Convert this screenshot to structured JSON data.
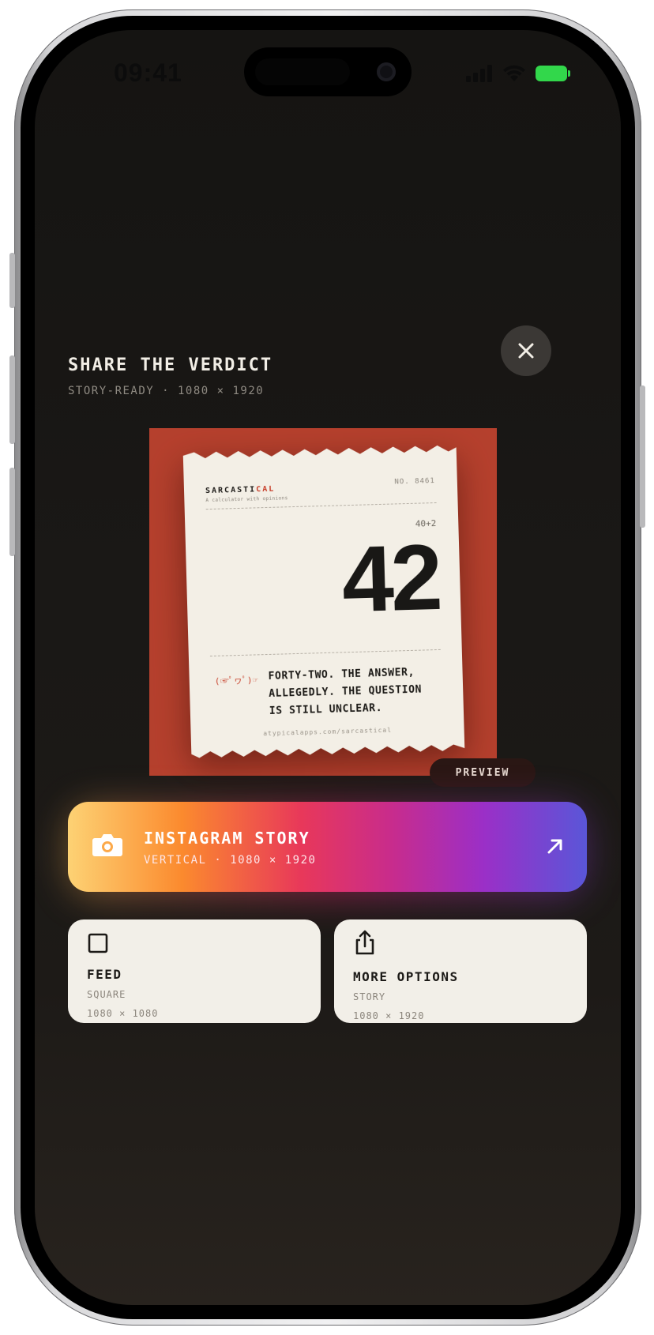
{
  "status_bar": {
    "time": "09:41"
  },
  "sheet": {
    "title": "SHARE THE VERDICT",
    "subtitle": "STORY-READY · 1080 × 1920",
    "close_icon": "close-icon"
  },
  "receipt": {
    "brand_main": "SARCASTI",
    "brand_accent": "CAL",
    "tagline": "A calculator with opinions",
    "ticket_no": "NO. 8461",
    "expression": "40+2",
    "result": "42",
    "face": "(☞ﾟヮﾟ)☞",
    "verdict": "FORTY-TWO. THE ANSWER, ALLEGEDLY. THE QUESTION IS STILL UNCLEAR.",
    "footer": "atypicalapps.com/sarcastical",
    "background": "#b5402d"
  },
  "preview_badge": "PREVIEW",
  "instagram": {
    "title": "INSTAGRAM STORY",
    "subtitle": "VERTICAL · 1080 × 1920",
    "icon": "camera-icon",
    "arrow_icon": "arrow-up-right-icon"
  },
  "options": [
    {
      "title": "FEED",
      "kind": "SQUARE",
      "size": "1080 × 1080",
      "icon": "square-icon"
    },
    {
      "title": "MORE OPTIONS",
      "kind": "STORY",
      "size": "1080 × 1920",
      "icon": "share-icon"
    }
  ],
  "colors": {
    "accent_red": "#c8412c",
    "card_cream": "#f2efe8",
    "battery_green": "#32d74b"
  }
}
